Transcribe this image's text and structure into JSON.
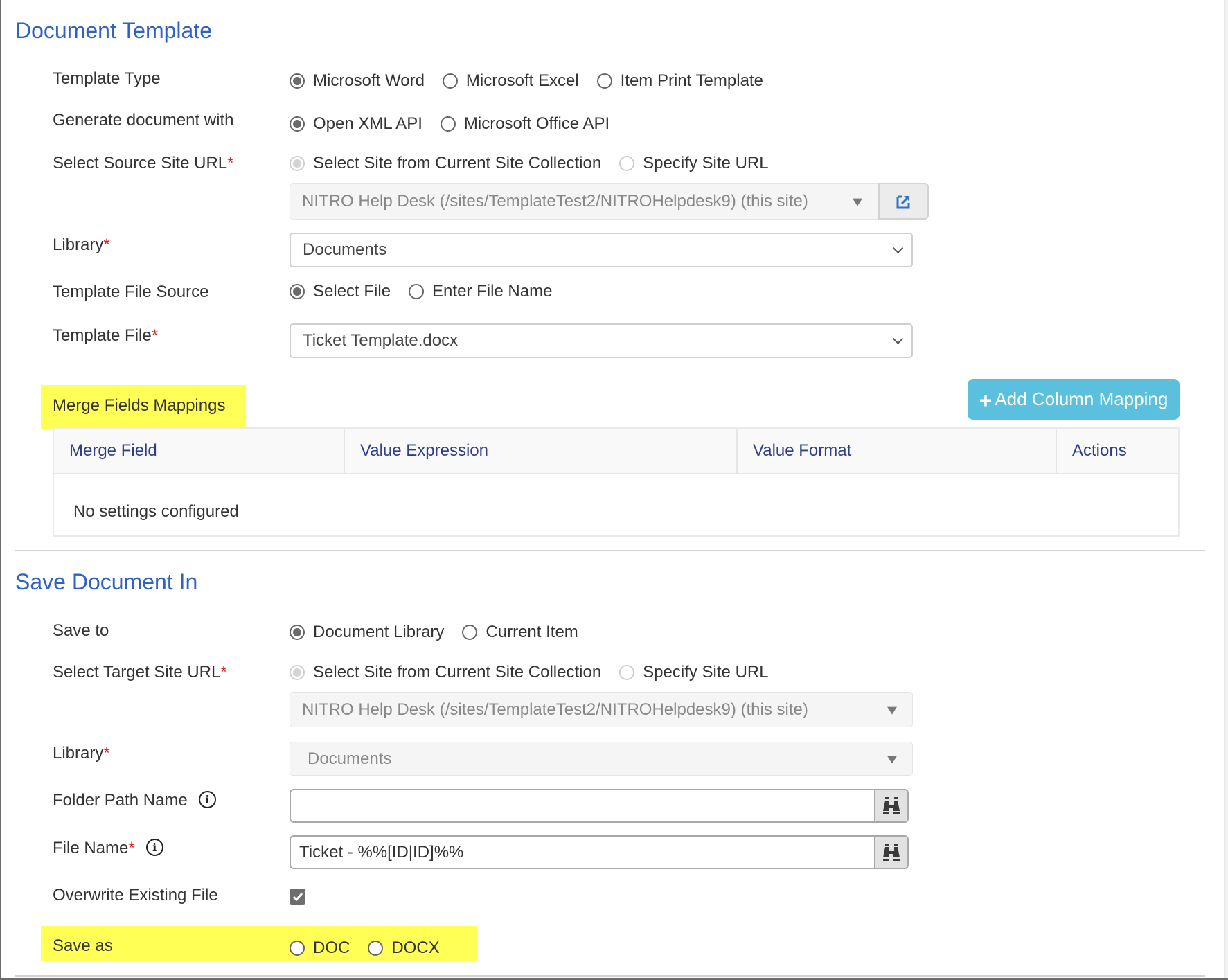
{
  "document_template": {
    "title": "Document Template",
    "template_type": {
      "label": "Template Type",
      "options": [
        "Microsoft Word",
        "Microsoft Excel",
        "Item Print Template"
      ],
      "selected": "Microsoft Word"
    },
    "generate_with": {
      "label": "Generate document with",
      "options": [
        "Open XML API",
        "Microsoft Office API"
      ],
      "selected": "Open XML API"
    },
    "source_site": {
      "label": "Select Source Site URL",
      "required_mark": "*",
      "options": [
        "Select Site from Current Site Collection",
        "Specify Site URL"
      ],
      "selected": "Select Site from Current Site Collection",
      "site_value": "NITRO Help Desk (/sites/TemplateTest2/NITROHelpdesk9) (this site)",
      "open_icon": "external-link-icon"
    },
    "library": {
      "label": "Library",
      "required_mark": "*",
      "value": "Documents"
    },
    "template_file_source": {
      "label": "Template File Source",
      "options": [
        "Select File",
        "Enter File Name"
      ],
      "selected": "Select File"
    },
    "template_file": {
      "label": "Template File",
      "required_mark": "*",
      "value": "Ticket Template.docx"
    },
    "merge_fields": {
      "label": "Merge Fields Mappings",
      "add_button": "Add Column Mapping",
      "add_icon": "plus-icon",
      "columns": [
        "Merge Field",
        "Value Expression",
        "Value Format",
        "Actions"
      ],
      "rows": [],
      "empty_message": "No settings configured"
    }
  },
  "save_document": {
    "title": "Save Document In",
    "save_to": {
      "label": "Save to",
      "options": [
        "Document Library",
        "Current Item"
      ],
      "selected": "Document Library"
    },
    "target_site": {
      "label": "Select Target Site URL",
      "required_mark": "*",
      "options": [
        "Select Site from Current Site Collection",
        "Specify Site URL"
      ],
      "selected": "Select Site from Current Site Collection",
      "site_value": "NITRO Help Desk (/sites/TemplateTest2/NITROHelpdesk9) (this site)"
    },
    "library": {
      "label": "Library",
      "required_mark": "*",
      "value": "Documents"
    },
    "folder_path": {
      "label": "Folder Path Name",
      "value": "",
      "info_icon": "info-icon",
      "picker_icon": "binoculars-icon"
    },
    "file_name": {
      "label": "File Name",
      "required_mark": "*",
      "value": "Ticket - %%[ID|ID]%%",
      "info_icon": "info-icon",
      "picker_icon": "binoculars-icon"
    },
    "overwrite": {
      "label": "Overwrite Existing File",
      "checked": true
    },
    "save_as": {
      "label": "Save as",
      "options": [
        "DOC",
        "DOCX"
      ],
      "selected": null
    }
  },
  "colors": {
    "section_title": "#2f62c2",
    "required": "#e01f1f",
    "add_button": "#5bc0de",
    "table_header_text": "#2e3e8a",
    "highlight": "#ffff55"
  }
}
